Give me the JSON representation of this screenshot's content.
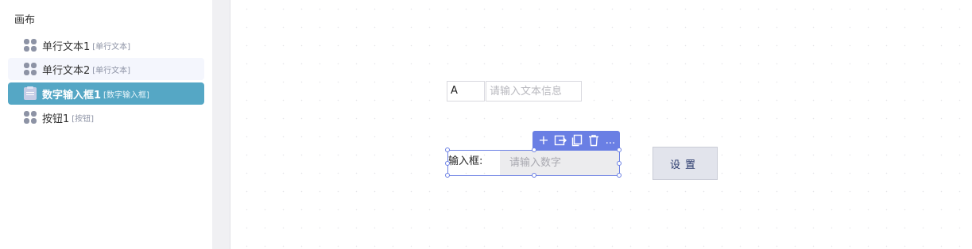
{
  "panel": {
    "title": "画布",
    "items": [
      {
        "label": "单行文本1",
        "tag": "[单行文本]",
        "icon": "grid-icon"
      },
      {
        "label": "单行文本2",
        "tag": "[单行文本]",
        "icon": "grid-icon"
      },
      {
        "label": "数字输入框1",
        "tag": "[数字输入框]",
        "icon": "clipboard-icon",
        "selected": true
      },
      {
        "label": "按钮1",
        "tag": "[按钮]",
        "icon": "grid-icon"
      }
    ]
  },
  "canvas": {
    "prefix_value": "A",
    "text_input": {
      "placeholder": "请输入文本信息"
    },
    "number_field": {
      "label": "输入框:",
      "placeholder": "请输入数字"
    },
    "toolbar": {
      "add": "+",
      "more": "..."
    },
    "button": {
      "label": "设置"
    }
  },
  "colors": {
    "accent": "#6a7fe4",
    "selected_item": "#55a7c5",
    "button_bg": "#e2e4ec"
  }
}
